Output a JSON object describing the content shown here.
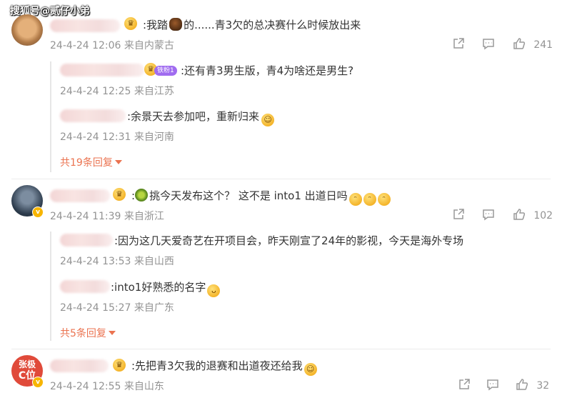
{
  "watermark": "搜狐号@贰仔小弟",
  "comments": [
    {
      "text": ":我踏  的......青3欠的总决赛什么时候放出来",
      "text_pre": ":我踏",
      "text_post": "的......青3欠的总决赛什么时候放出来",
      "meta": "24-4-24 12:06 来自内蒙古",
      "likes": "241",
      "replies": [
        {
          "text": ":还有青3男生版，青4为啥还是男生?",
          "badge": "铁粉1",
          "meta": "24-4-24 12:25 来自江苏"
        },
        {
          "text": ":余景天去参加吧，重新归来",
          "meta": "24-4-24 12:31 来自河南"
        }
      ],
      "more": "共19条回复"
    },
    {
      "text": "挑今天发布这个？ 这不是 into1 出道日吗",
      "meta": "24-4-24 11:39 来自浙江",
      "likes": "102",
      "replies": [
        {
          "text": ":因为这几天爱奇艺在开项目会，昨天刚宣了24年的影视，今天是海外专场",
          "meta": "24-4-24 13:53 来自山西"
        },
        {
          "text": ":into1好熟悉的名字",
          "meta": "24-4-24 15:27 来自广东"
        }
      ],
      "more": "共5条回复"
    },
    {
      "text": ":先把青3欠我的退赛和出道夜还给我",
      "meta": "24-4-24 12:55 来自山东",
      "likes": "32",
      "avatar_text_1": "张极",
      "avatar_text_2": "C位"
    }
  ],
  "colors": {
    "accent": "#eb7350",
    "meta": "#939393",
    "text": "#333333"
  }
}
